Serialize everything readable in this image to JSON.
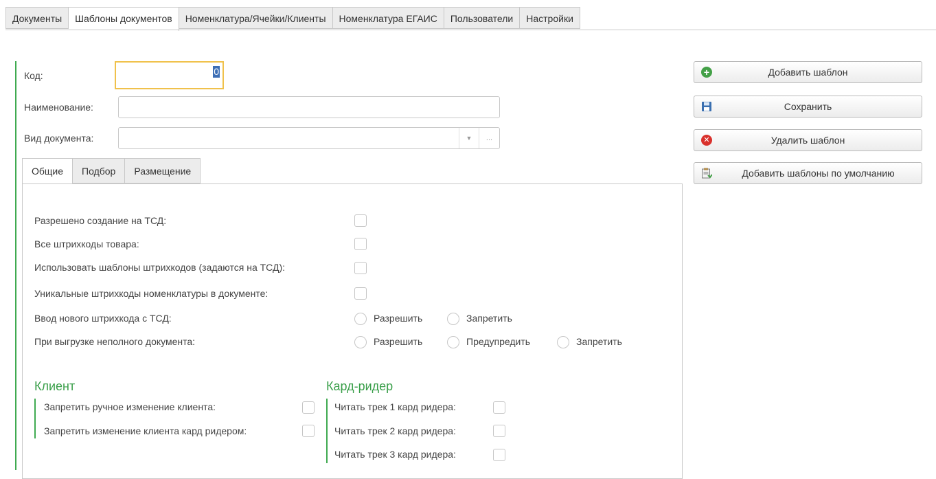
{
  "top_tabs": [
    "Документы",
    "Шаблоны документов",
    "Номенклатура/Ячейки/Клиенты",
    "Номенклатура ЕГАИС",
    "Пользователи",
    "Настройки"
  ],
  "form": {
    "code_label": "Код:",
    "code_value": "0",
    "name_label": "Наименование:",
    "name_value": "",
    "doctype_label": "Вид документа:",
    "doctype_value": "",
    "doctype_more": "..."
  },
  "inner_tabs": [
    "Общие",
    "Подбор",
    "Размещение"
  ],
  "general": {
    "allow_create_label": "Разрешено создание на ТСД:",
    "all_barcodes_label": "Все штрихкоды товара:",
    "use_templates_label": "Использовать шаблоны штрихкодов (задаются на ТСД):",
    "unique_barcodes_label": "Уникальные штрихкоды номенклатуры в документе:",
    "new_barcode_label": "Ввод нового штрихкода с ТСД:",
    "new_barcode_opt1": "Разрешить",
    "new_barcode_opt2": "Запретить",
    "partial_upload_label": "При выгрузке неполного документа:",
    "partial_opt1": "Разрешить",
    "partial_opt2": "Предупредить",
    "partial_opt3": "Запретить"
  },
  "client": {
    "title": "Клиент",
    "manual_change_label": "Запретить ручное изменение клиента:",
    "card_change_label": "Запретить изменение клиента кард ридером:"
  },
  "card_reader": {
    "title": "Кард-ридер",
    "track1_label": "Читать трек 1 кард ридера:",
    "track2_label": "Читать трек 2 кард ридера:",
    "track3_label": "Читать трек 3 кард ридера:"
  },
  "buttons": {
    "add_template": "Добавить шаблон",
    "save": "Сохранить",
    "delete_template": "Удалить шаблон",
    "add_defaults": "Добавить шаблоны по умолчанию"
  },
  "colors": {
    "accent_green": "#3faa50",
    "focus_yellow": "#f0c14b",
    "selection_blue": "#3d6eb5",
    "delete_red": "#d9312c"
  }
}
